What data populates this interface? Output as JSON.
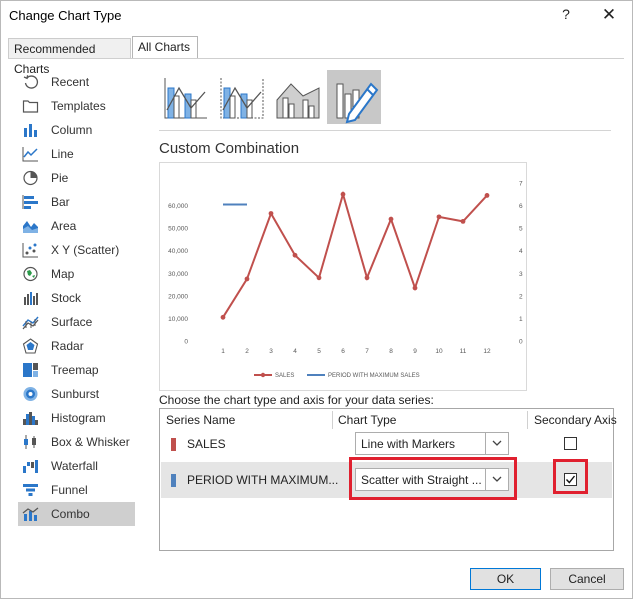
{
  "dialog": {
    "title": "Change Chart Type",
    "help_label": "?",
    "close_label": "✕"
  },
  "tabs": [
    {
      "label": "Recommended Charts",
      "active": false
    },
    {
      "label": "All Charts",
      "active": true
    }
  ],
  "sidebar": {
    "items": [
      {
        "label": "Recent",
        "icon": "recent-icon"
      },
      {
        "label": "Templates",
        "icon": "templates-icon"
      },
      {
        "label": "Column",
        "icon": "column-chart-icon"
      },
      {
        "label": "Line",
        "icon": "line-chart-icon"
      },
      {
        "label": "Pie",
        "icon": "pie-chart-icon"
      },
      {
        "label": "Bar",
        "icon": "bar-chart-icon"
      },
      {
        "label": "Area",
        "icon": "area-chart-icon"
      },
      {
        "label": "X Y (Scatter)",
        "icon": "scatter-chart-icon"
      },
      {
        "label": "Map",
        "icon": "map-chart-icon"
      },
      {
        "label": "Stock",
        "icon": "stock-chart-icon"
      },
      {
        "label": "Surface",
        "icon": "surface-chart-icon"
      },
      {
        "label": "Radar",
        "icon": "radar-chart-icon"
      },
      {
        "label": "Treemap",
        "icon": "treemap-chart-icon"
      },
      {
        "label": "Sunburst",
        "icon": "sunburst-chart-icon"
      },
      {
        "label": "Histogram",
        "icon": "histogram-chart-icon"
      },
      {
        "label": "Box & Whisker",
        "icon": "box-whisker-chart-icon"
      },
      {
        "label": "Waterfall",
        "icon": "waterfall-chart-icon"
      },
      {
        "label": "Funnel",
        "icon": "funnel-chart-icon"
      },
      {
        "label": "Combo",
        "icon": "combo-chart-icon",
        "selected": true
      }
    ]
  },
  "subtypes": [
    {
      "name": "clustered-column-line-subtype"
    },
    {
      "name": "clustered-column-line-secondary-subtype"
    },
    {
      "name": "stacked-area-clustered-column-subtype"
    },
    {
      "name": "custom-combination-subtype",
      "selected": true
    }
  ],
  "main": {
    "section_title": "Custom Combination",
    "choose_text": "Choose the chart type and axis for your data series:"
  },
  "series_table": {
    "headers": {
      "name": "Series Name",
      "type": "Chart Type",
      "axis": "Secondary Axis"
    },
    "rows": [
      {
        "name": "SALES",
        "color": "#c0504d",
        "chart_type": "Line with Markers",
        "secondary": false
      },
      {
        "name": "PERIOD WITH MAXIMUM...",
        "color": "#4f81bd",
        "chart_type": "Scatter with Straight ...",
        "secondary": true,
        "selected": true
      }
    ]
  },
  "buttons": {
    "ok": "OK",
    "cancel": "Cancel"
  },
  "colors": {
    "sales": "#c0504d",
    "period": "#4f81bd",
    "highlight": "#e0202f",
    "accent": "#0078d7"
  },
  "chart_data": {
    "type": "line",
    "x": [
      1,
      2,
      3,
      4,
      5,
      6,
      7,
      8,
      9,
      10,
      11,
      12
    ],
    "series": [
      {
        "name": "SALES",
        "axis": "primary",
        "marker": true,
        "values": [
          10500,
          27500,
          56500,
          38000,
          28000,
          65000,
          28000,
          54000,
          23500,
          55000,
          53000,
          64500
        ]
      },
      {
        "name": "PERIOD WITH MAXIMUM SALES",
        "axis": "secondary",
        "marker": false,
        "x": [
          1,
          2
        ],
        "values": [
          6.05,
          6.05
        ]
      }
    ],
    "y_ticks": [
      "0",
      "10,000",
      "20,000",
      "30,000",
      "40,000",
      "50,000",
      "60,000"
    ],
    "y2_ticks": [
      "0",
      "1",
      "2",
      "3",
      "4",
      "5",
      "6",
      "7"
    ],
    "ylim": [
      0,
      70000
    ],
    "y2lim": [
      0,
      7
    ],
    "grid": false,
    "legend_position": "bottom"
  }
}
